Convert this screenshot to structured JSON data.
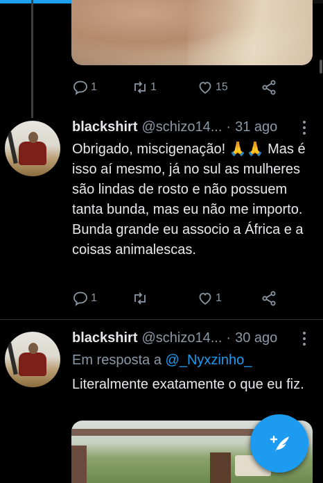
{
  "progress": {
    "fraction": 0.31
  },
  "tweet_top": {
    "reply_count": "1",
    "retweet_count": "1",
    "like_count": "15"
  },
  "tweet_1": {
    "name": "blackshirt",
    "handle": "@schizo14...",
    "separator": "·",
    "date": "31 ago",
    "text": "Obrigado, miscigenação! 🙏🙏 Mas é isso aí mesmo, já no sul as mulheres são lindas de rosto e não possuem tanta bunda, mas eu não me importo. Bunda grande eu associo a África e a coisas animalescas.",
    "reply_count": "1",
    "retweet_count": "",
    "like_count": "1"
  },
  "tweet_2": {
    "name": "blackshirt",
    "handle": "@schizo14...",
    "separator": "·",
    "date": "30 ago",
    "reply_prefix": "Em resposta a",
    "reply_mention": "@_Nyxzinho_",
    "text": "Literalmente exatamente o que eu fiz."
  },
  "icons": {
    "reply": "reply-icon",
    "retweet": "retweet-icon",
    "like": "heart-icon",
    "share": "share-icon",
    "more": "more-icon",
    "compose": "compose-tweet-icon"
  },
  "colors": {
    "accent": "#1d9bf0",
    "background": "#000000",
    "secondary_text": "#8b98a5"
  }
}
